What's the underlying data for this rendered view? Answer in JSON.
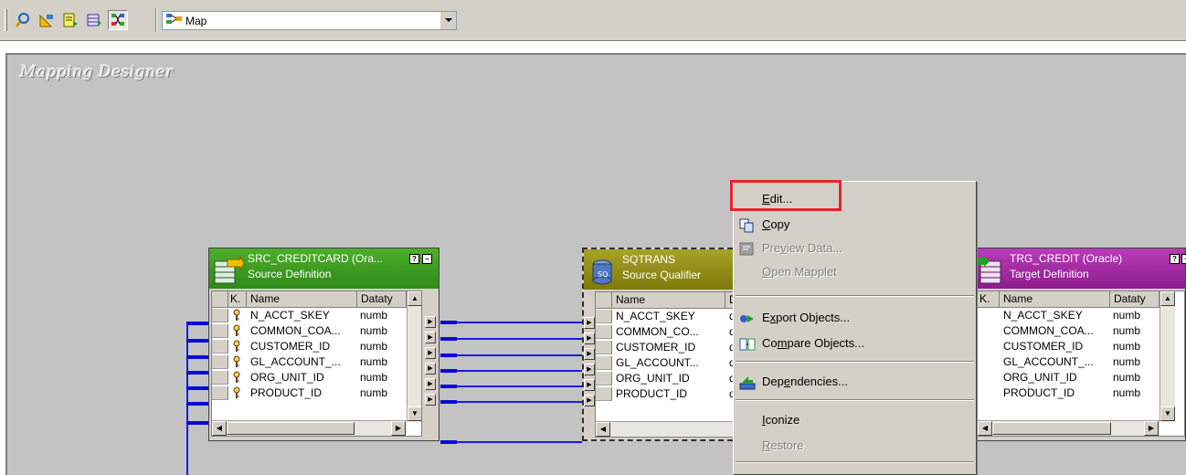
{
  "toolbar": {
    "icons": [
      "query-icon",
      "arrange-icon",
      "table-icon",
      "grid-icon",
      "link-icon"
    ],
    "mode_combo": {
      "icon": "mapping-icon",
      "value": "Map"
    }
  },
  "canvas": {
    "title": "Mapping Designer"
  },
  "source": {
    "title": "SRC_CREDITCARD (Ora...",
    "subtitle": "Source Definition",
    "columns": {
      "key": "K.",
      "name": "Name",
      "datatype": "Dataty"
    },
    "rows": [
      {
        "name": "N_ACCT_SKEY",
        "type": "numb"
      },
      {
        "name": "COMMON_COA...",
        "type": "numb"
      },
      {
        "name": "CUSTOMER_ID",
        "type": "numb"
      },
      {
        "name": "GL_ACCOUNT_...",
        "type": "numb"
      },
      {
        "name": "ORG_UNIT_ID",
        "type": "numb"
      },
      {
        "name": "PRODUCT_ID",
        "type": "numb"
      }
    ]
  },
  "qualifier": {
    "title": "SQTRANS",
    "subtitle": "Source Qualifier",
    "columns": {
      "name": "Name",
      "datatype": "D"
    },
    "rows": [
      {
        "name": "N_ACCT_SKEY",
        "type": "d"
      },
      {
        "name": "COMMON_CO...",
        "type": "d"
      },
      {
        "name": "CUSTOMER_ID",
        "type": "d"
      },
      {
        "name": "GL_ACCOUNT...",
        "type": "d"
      },
      {
        "name": "ORG_UNIT_ID",
        "type": "d"
      },
      {
        "name": "PRODUCT_ID",
        "type": "d"
      }
    ]
  },
  "target": {
    "title": "TRG_CREDIT (Oracle)",
    "subtitle": "Target Definition",
    "columns": {
      "key": "K.",
      "name": "Name",
      "datatype": "Dataty"
    },
    "rows": [
      {
        "name": "N_ACCT_SKEY",
        "type": "numb"
      },
      {
        "name": "COMMON_COA...",
        "type": "numb"
      },
      {
        "name": "CUSTOMER_ID",
        "type": "numb"
      },
      {
        "name": "GL_ACCOUNT_...",
        "type": "numb"
      },
      {
        "name": "ORG_UNIT_ID",
        "type": "numb"
      },
      {
        "name": "PRODUCT_ID",
        "type": "numb"
      }
    ]
  },
  "context_menu": {
    "edit": {
      "pre": "",
      "acc": "E",
      "post": "dit..."
    },
    "copy": {
      "pre": "",
      "acc": "C",
      "post": "opy"
    },
    "preview": {
      "pre": "Pre",
      "acc": "v",
      "post": "iew Data..."
    },
    "open_mapplet": {
      "pre": "",
      "acc": "O",
      "post": "pen Mapplet"
    },
    "export": {
      "pre": "E",
      "acc": "x",
      "post": "port Objects..."
    },
    "compare": {
      "pre": "Co",
      "acc": "m",
      "post": "pare Objects..."
    },
    "dependencies": {
      "pre": "Dep",
      "acc": "e",
      "post": "ndencies..."
    },
    "iconize": {
      "pre": "",
      "acc": "I",
      "post": "conize"
    },
    "restore": {
      "pre": "",
      "acc": "R",
      "post": "estore"
    }
  },
  "colors": {
    "source_header": "#3f9a1f",
    "qualifier_header": "#8f8a10",
    "target_header": "#a328a3",
    "link": "#1a1ae6",
    "highlight": "#e8232b"
  }
}
